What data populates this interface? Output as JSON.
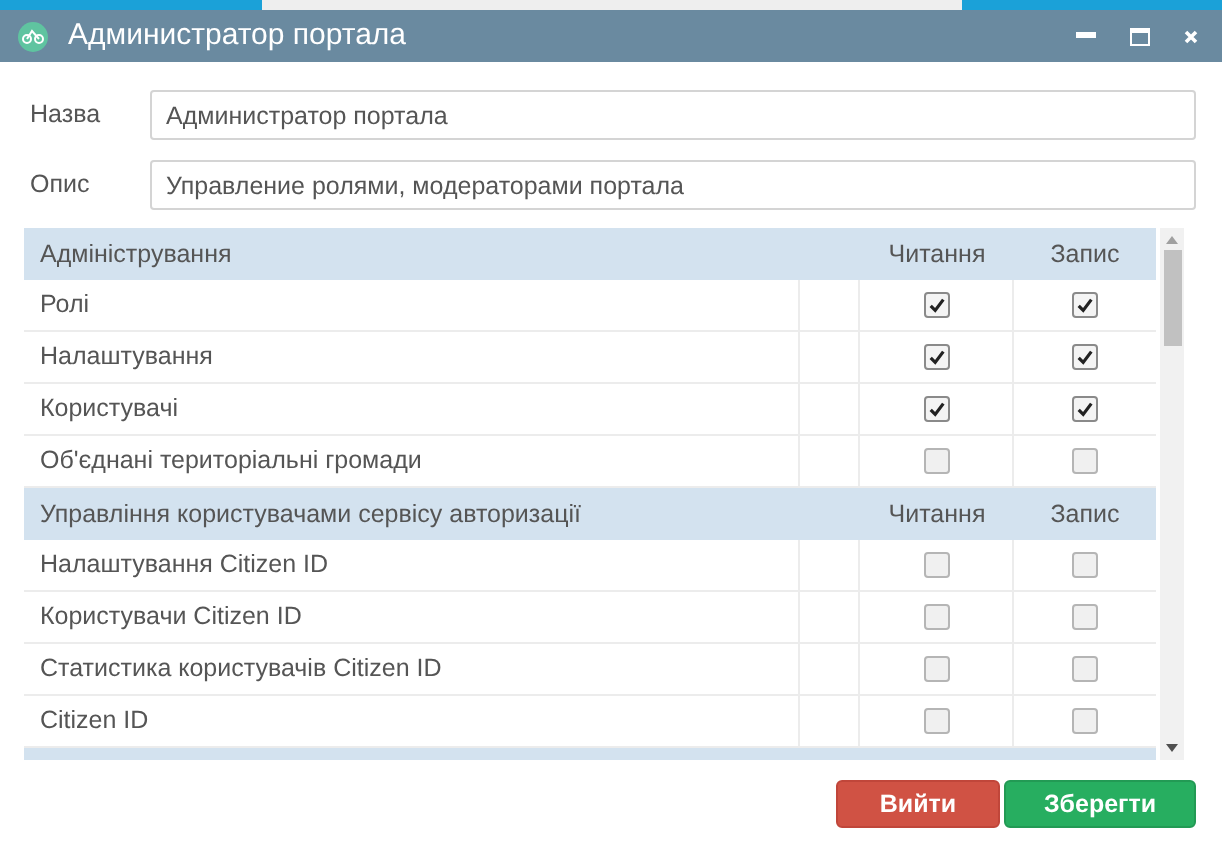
{
  "window": {
    "title": "Администратор портала"
  },
  "fields": [
    {
      "label": "Назва",
      "value": "Администратор портала"
    },
    {
      "label": "Опис",
      "value": "Управление ролями, модераторами портала"
    }
  ],
  "sections": [
    {
      "title": "Адміністрування",
      "read_header": "Читання",
      "write_header": "Запис",
      "rows": [
        {
          "name": "Ролі",
          "read": true,
          "write": true
        },
        {
          "name": "Налаштування",
          "read": true,
          "write": true
        },
        {
          "name": "Користувачі",
          "read": true,
          "write": true
        },
        {
          "name": "Об'єднані територіальні громади",
          "read": false,
          "write": false
        }
      ]
    },
    {
      "title": "Управління користувачами сервісу авторизації",
      "read_header": "Читання",
      "write_header": "Запис",
      "rows": [
        {
          "name": "Налаштування Citizen ID",
          "read": false,
          "write": false
        },
        {
          "name": "Користувачи Citizen ID",
          "read": false,
          "write": false
        },
        {
          "name": "Статистика користувачів Citizen ID",
          "read": false,
          "write": false
        },
        {
          "name": "Citizen ID",
          "read": false,
          "write": false
        }
      ]
    }
  ],
  "buttons": [
    {
      "label": "Вийти",
      "kind": "cancel"
    },
    {
      "label": "Зберегти",
      "kind": "save"
    }
  ]
}
